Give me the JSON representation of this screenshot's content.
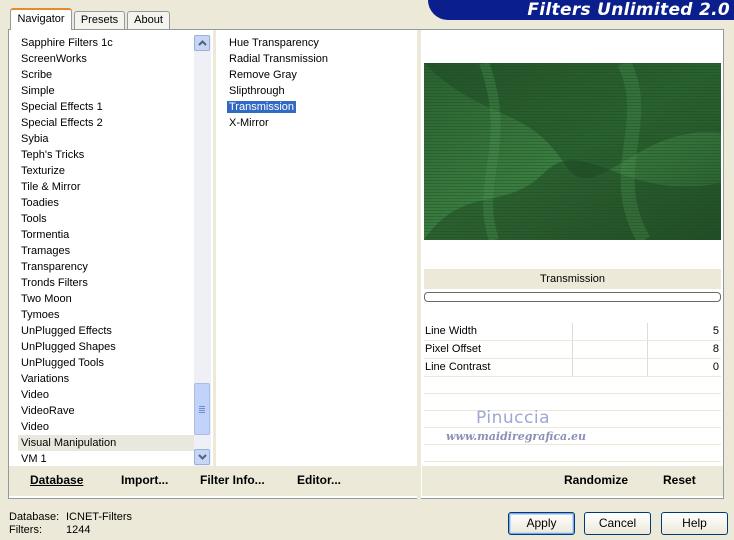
{
  "window": {
    "title": "Filters Unlimited 2.0"
  },
  "tabs": [
    {
      "label": "Navigator",
      "active": true
    },
    {
      "label": "Presets",
      "active": false
    },
    {
      "label": "About",
      "active": false
    }
  ],
  "categories": [
    "Sapphire Filters 1c",
    "ScreenWorks",
    "Scribe",
    "Simple",
    "Special Effects 1",
    "Special Effects 2",
    "Sybia",
    "Teph's Tricks",
    "Texturize",
    "Tile & Mirror",
    "Toadies",
    "Tools",
    "Tormentia",
    "Tramages",
    "Transparency",
    "Tronds Filters",
    "Two Moon",
    "Tymoes",
    "UnPlugged Effects",
    "UnPlugged Shapes",
    "UnPlugged Tools",
    "Variations",
    "Video",
    "VideoRave",
    "Video",
    "Visual Manipulation",
    "VM 1"
  ],
  "selected_category": "Visual Manipulation",
  "filters": [
    "Hue Transparency",
    "Radial Transmission",
    "Remove Gray",
    "Slipthrough",
    "Transmission",
    "X-Mirror"
  ],
  "selected_filter": "Transmission",
  "left_buttons": {
    "database": "Database",
    "import": "Import...",
    "filter_info": "Filter Info...",
    "editor": "Editor..."
  },
  "preview": {
    "filter_name": "Transmission",
    "progress": 0
  },
  "params": [
    {
      "label": "Line Width",
      "value": "5"
    },
    {
      "label": "Pixel Offset",
      "value": "8"
    },
    {
      "label": "Line Contrast",
      "value": "0"
    }
  ],
  "watermark": {
    "name": "Pinuccia",
    "site": "www.maidiregrafica.eu"
  },
  "right_buttons": {
    "randomize": "Randomize",
    "reset": "Reset"
  },
  "status": {
    "database_label": "Database:",
    "database_value": "ICNET-Filters",
    "filters_label": "Filters:",
    "filters_value": "1244"
  },
  "dialog_buttons": {
    "apply": "Apply",
    "cancel": "Cancel",
    "help": "Help"
  },
  "colors": {
    "banner": "#0a1e8c",
    "selection": "#316ac5",
    "preview_green": "#2e6a33"
  }
}
